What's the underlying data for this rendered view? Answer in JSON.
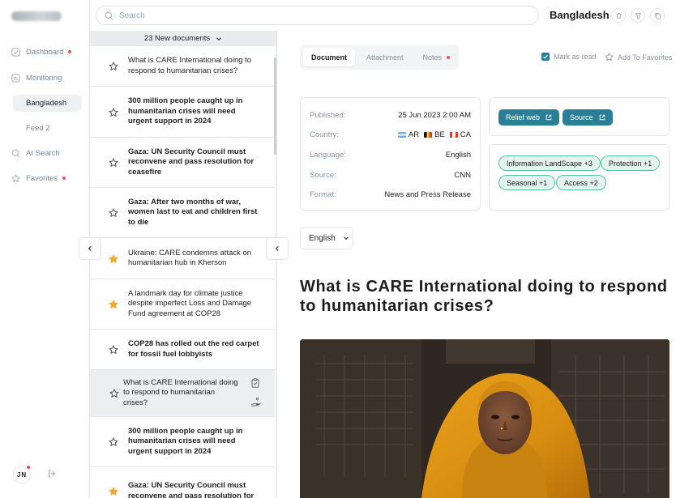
{
  "sidebar": {
    "items": [
      {
        "label": "Dashboard",
        "icon": "dashboard-icon",
        "dot": true
      },
      {
        "label": "Monitoring",
        "icon": "monitoring-icon",
        "dot": false
      },
      {
        "label": "AI Search",
        "icon": "ai-search-icon",
        "dot": false
      },
      {
        "label": "Favorites",
        "icon": "star-icon",
        "dot": true
      }
    ],
    "sub_items": [
      {
        "label": "Bangladesh",
        "active": true
      },
      {
        "label": "Feed 2",
        "active": false
      }
    ],
    "user_initials": "JN"
  },
  "search": {
    "placeholder": "Search"
  },
  "header": {
    "title": "Bangladesh"
  },
  "list": {
    "header": "23 New documents",
    "items": [
      {
        "title": "What is CARE International doing to respond to humanitarian crises?",
        "bold": false,
        "starred": false
      },
      {
        "title": "300 million people caught up in humanitarian crises will need urgent support in 2024",
        "bold": true,
        "starred": false
      },
      {
        "title": "Gaza: UN Security Council must reconvene and pass resolution for ceasefire",
        "bold": true,
        "starred": false
      },
      {
        "title": "Gaza: After two months of war, women last to eat and children first to die",
        "bold": true,
        "starred": false
      },
      {
        "title": "Ukraine: CARE condemns attack on humanitarian hub in Kherson",
        "bold": false,
        "starred": true
      },
      {
        "title": "A landmark day for climate justice despite imperfect Loss and Damage Fund agreement  at COP28",
        "bold": false,
        "starred": true
      },
      {
        "title": "COP28 has rolled out the red carpet for fossil fuel lobbyists",
        "bold": true,
        "starred": false
      },
      {
        "title": "What is CARE International doing to respond to humanitarian crises?",
        "bold": false,
        "starred": false,
        "selected": true
      },
      {
        "title": "300 million people caught up in humanitarian crises will need urgent support in 2024",
        "bold": true,
        "starred": false
      },
      {
        "title": "Gaza: UN Security Council must reconvene and pass resolution for",
        "bold": true,
        "starred": true
      }
    ]
  },
  "tabs": [
    {
      "label": "Document",
      "active": true
    },
    {
      "label": "Attachment",
      "active": false
    },
    {
      "label": "Notes",
      "active": false,
      "dot": true
    }
  ],
  "actions": {
    "mark_read": "Mark as read",
    "mark_read_checked": true,
    "add_favorite": "Add To Favorites"
  },
  "meta": {
    "published_label": "Published:",
    "published": "25 Jun 2023 2:00 AM",
    "country_label": "Country:",
    "countries": [
      {
        "code": "AR",
        "color": "#74acdf"
      },
      {
        "code": "BE",
        "color": "#f5d000"
      },
      {
        "code": "CA",
        "color": "#e0362c"
      }
    ],
    "language_label": "Language:",
    "language": "English",
    "source_label": "Source:",
    "source": "CNN",
    "format_label": "Format:",
    "format": "News and Press Release"
  },
  "links": [
    {
      "label": "Relief web"
    },
    {
      "label": "Source"
    }
  ],
  "tags": [
    {
      "label": "Information LandScape +3"
    },
    {
      "label": "Protection +1"
    },
    {
      "label": "Seasonal +1"
    },
    {
      "label": "Access +2"
    }
  ],
  "language_select": {
    "value": "English"
  },
  "document": {
    "title": "What is CARE International doing to respond to humanitarian crises?"
  },
  "colors": {
    "accent": "#2a7e95",
    "tag_border": "#55c59a",
    "tag_bg": "#e3f4ee",
    "notify": "#e8524a"
  }
}
